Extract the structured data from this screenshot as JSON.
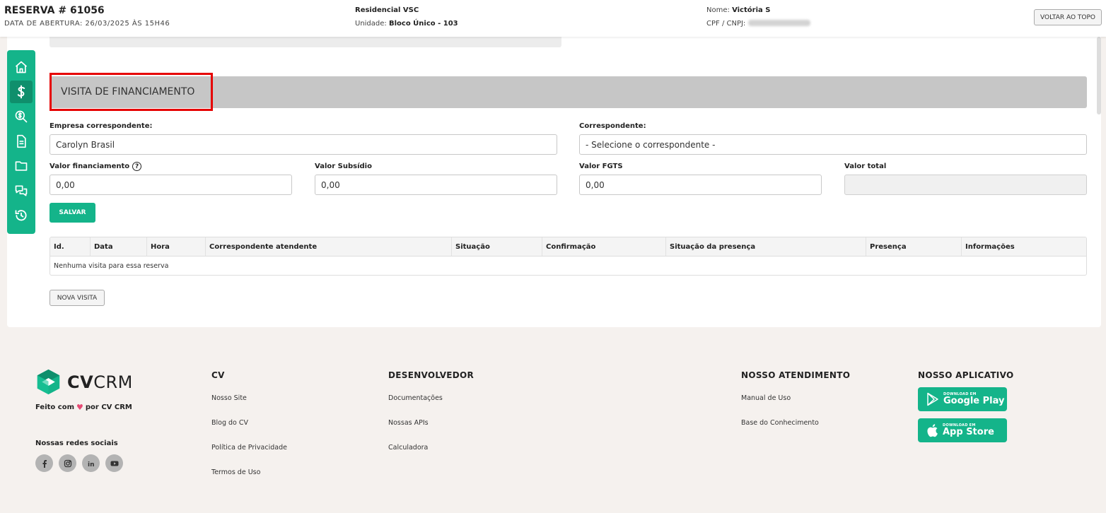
{
  "header": {
    "reserva": "RESERVA # 61056",
    "data_abertura": "DATA DE ABERTURA: 26/03/2025 ÀS 15H46",
    "empreendimento": "Residencial VSC",
    "unidade_label": "Unidade:",
    "unidade_value": "Bloco Único - 103",
    "nome_label": "Nome:",
    "nome_value": "Victória S",
    "cpf_label": "CPF / CNPJ:",
    "voltar_topo": "VOLTAR AO TOPO"
  },
  "sidebar": {
    "items": [
      {
        "icon": "home-icon",
        "active": false
      },
      {
        "icon": "dollar-icon",
        "active": true
      },
      {
        "icon": "search-dollar-icon",
        "active": false
      },
      {
        "icon": "document-icon",
        "active": false
      },
      {
        "icon": "folder-icon",
        "active": false
      },
      {
        "icon": "chat-icon",
        "active": false
      },
      {
        "icon": "history-icon",
        "active": false
      }
    ]
  },
  "section": {
    "title": "VISITA DE FINANCIAMENTO"
  },
  "form": {
    "empresa_label": "Empresa correspondente:",
    "empresa_value": "Carolyn Brasil",
    "correspondente_label": "Correspondente:",
    "correspondente_value": "- Selecione o correspondente -",
    "valor_financiamento_label": "Valor financiamento",
    "valor_financiamento_value": "0,00",
    "valor_subsidio_label": "Valor Subsídio",
    "valor_subsidio_value": "0,00",
    "valor_fgts_label": "Valor FGTS",
    "valor_fgts_value": "0,00",
    "valor_total_label": "Valor total",
    "valor_total_value": "",
    "salvar": "SALVAR"
  },
  "table": {
    "columns": [
      "Id.",
      "Data",
      "Hora",
      "Correspondente atendente",
      "Situação",
      "Confirmação",
      "Situação da presença",
      "Presença",
      "Informações"
    ],
    "empty_message": "Nenhuma visita para essa reserva"
  },
  "nova_visita": "NOVA VISITA",
  "footer": {
    "logo_bold": "CV",
    "logo_light": "CRM",
    "made_prefix": "Feito com",
    "made_suffix": "por CV CRM",
    "social_title": "Nossas redes sociais",
    "socials": [
      "facebook-icon",
      "instagram-icon",
      "linkedin-icon",
      "youtube-icon"
    ],
    "col_cv": {
      "title": "CV",
      "links": [
        "Nosso Site",
        "Blog do CV",
        "Política de Privacidade",
        "Termos de Uso"
      ]
    },
    "col_dev": {
      "title": "DESENVOLVEDOR",
      "links": [
        "Documentações",
        "Nossas APIs",
        "Calculadora"
      ]
    },
    "col_atend": {
      "title": "NOSSO ATENDIMENTO",
      "links": [
        "Manual de Uso",
        "Base do Conhecimento"
      ]
    },
    "col_app": {
      "title": "NOSSO APLICATIVO",
      "google_small": "DOWNLOAD EM",
      "google_big": "Google Play",
      "apple_small": "DOWNLOAD EM",
      "apple_big": "App Store"
    }
  },
  "colors": {
    "brand_green": "#14b48a",
    "highlight_red": "#e60000",
    "section_gray": "#c6c6c6",
    "footer_bg": "#f5f1ee"
  }
}
